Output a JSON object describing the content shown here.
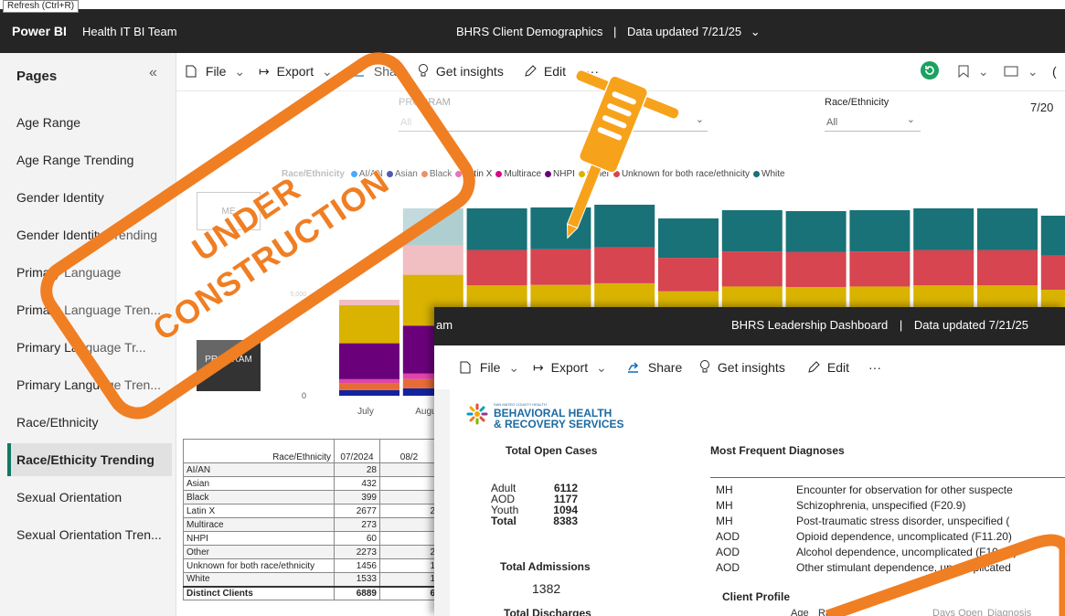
{
  "tooltip": "Refresh (Ctrl+R)",
  "topbar": {
    "brand": "Power BI",
    "workspace": "Health IT BI Team",
    "report_title": "BHRS Client Demographics",
    "updated": "Data updated 7/21/25",
    "updated_chevron": "⌄"
  },
  "sidebar": {
    "header": "Pages",
    "collapse": "«",
    "items": [
      {
        "label": "Age Range"
      },
      {
        "label": "Age Range Trending"
      },
      {
        "label": "Gender Identity"
      },
      {
        "label": "Gender Identity Trending"
      },
      {
        "label": "Primary Language"
      },
      {
        "label": "Primary Language Tren..."
      },
      {
        "label": "Primary Language Tr..."
      },
      {
        "label": "Primary Language Tren..."
      },
      {
        "label": "Race/Ethnicity"
      },
      {
        "label": "Race/Ethicity Trending"
      },
      {
        "label": "Sexual Orientation"
      },
      {
        "label": "Sexual Orientation Tren..."
      }
    ]
  },
  "toolbar": {
    "file": "File",
    "export": "Export",
    "share": "Share",
    "insights": "Get insights",
    "edit": "Edit",
    "more": "···",
    "chevron": "⌄"
  },
  "filters": {
    "program_label": "PROGRAM",
    "program_value": "All",
    "race_label": "Race/Ethnicity",
    "race_value": "All",
    "date_partial": "7/20"
  },
  "legend": {
    "title": "Race/Ethnicity",
    "items": [
      {
        "name": "AI/AN",
        "color": "#118dff"
      },
      {
        "name": "Asian",
        "color": "#12239e"
      },
      {
        "name": "Black",
        "color": "#e66c37"
      },
      {
        "name": "Latin X",
        "color": "#e044a7"
      },
      {
        "name": "Multirace",
        "color": "#d9038a"
      },
      {
        "name": "NHPI",
        "color": "#6b007b"
      },
      {
        "name": "Other",
        "color": "#d9b300"
      },
      {
        "name": "Unknown for both race/ethnicity",
        "color": "#d64550"
      },
      {
        "name": "White",
        "color": "#197278"
      }
    ]
  },
  "left_buttons": {
    "me": "ME",
    "program": "PROGRAM"
  },
  "chart_data": {
    "type": "bar",
    "stacked": true,
    "categories": [
      "July",
      "August",
      "",
      "",
      "",
      "",
      "",
      "",
      "",
      "",
      "",
      ""
    ],
    "y_ticks": [
      "0",
      "5,000"
    ],
    "series_colors": [
      "#12239e",
      "#e66c37",
      "#e044a7",
      "#6b007b",
      "#d9b300",
      "#d64550",
      "#197278"
    ]
  },
  "table": {
    "header_col": "Race/Ethnicity",
    "periods": [
      "07/2024",
      "08/2"
    ],
    "rows": [
      {
        "label": "AI/AN",
        "v1": "28",
        "v2": ""
      },
      {
        "label": "Asian",
        "v1": "432",
        "v2": ""
      },
      {
        "label": "Black",
        "v1": "399",
        "v2": ""
      },
      {
        "label": "Latin X",
        "v1": "2677",
        "v2": "2"
      },
      {
        "label": "Multirace",
        "v1": "273",
        "v2": ""
      },
      {
        "label": "NHPI",
        "v1": "60",
        "v2": ""
      },
      {
        "label": "Other",
        "v1": "2273",
        "v2": "2"
      },
      {
        "label": "Unknown for both race/ethnicity",
        "v1": "1456",
        "v2": "1"
      },
      {
        "label": "White",
        "v1": "1533",
        "v2": "1"
      }
    ],
    "total": {
      "label": "Distinct Clients",
      "v1": "6889",
      "v2": "6"
    }
  },
  "overlay": {
    "workspace_tail": "am",
    "title": "BHRS Leadership Dashboard",
    "updated": "Data updated 7/21/25",
    "logo_small": "SAN MATEO COUNTY HEALTH",
    "logo_line1": "BEHAVIORAL HEALTH",
    "logo_line2": "& RECOVERY SERVICES",
    "open_cases_title": "Total Open Cases",
    "open_cases": [
      {
        "label": "Adult",
        "value": "6112"
      },
      {
        "label": "AOD",
        "value": "1177"
      },
      {
        "label": "Youth",
        "value": "1094"
      },
      {
        "label": "Total",
        "value": "8383"
      }
    ],
    "admissions_title": "Total Admissions",
    "admissions_value": "1382",
    "discharges_title": "Total Discharges",
    "diag_title": "Most Frequent Diagnoses",
    "diagnoses": [
      {
        "type": "MH",
        "desc": "Encounter for observation for other suspecte"
      },
      {
        "type": "MH",
        "desc": "Schizophrenia, unspecified (F20.9)"
      },
      {
        "type": "MH",
        "desc": "Post-traumatic stress disorder, unspecified ("
      },
      {
        "type": "AOD",
        "desc": "Opioid dependence, uncomplicated (F11.20)"
      },
      {
        "type": "AOD",
        "desc": "Alcohol dependence, uncomplicated (F10.20)"
      },
      {
        "type": "AOD",
        "desc": "Other stimulant dependence, uncomplicated"
      }
    ],
    "client_profile": "Client Profile",
    "profile_cols": [
      "Age",
      "Race",
      "Days Open",
      "Diagnosis"
    ]
  },
  "stamp": {
    "line1": "UNDER",
    "line2": "CONSTRUCTION"
  }
}
